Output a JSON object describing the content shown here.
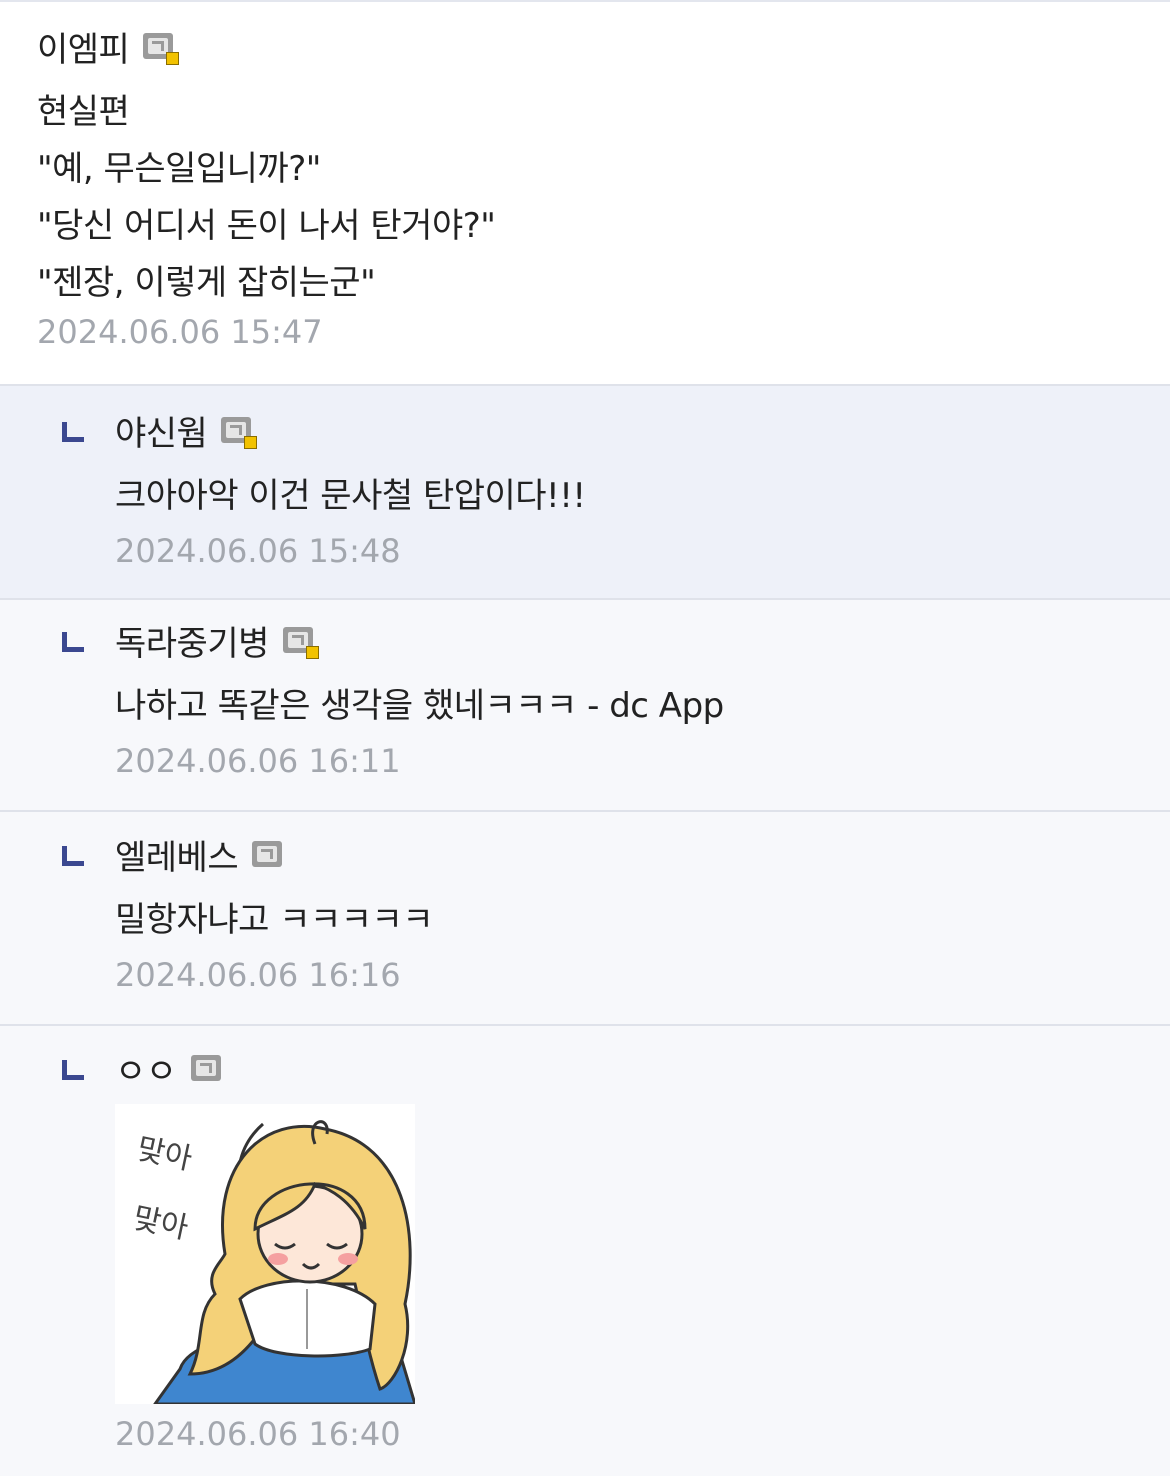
{
  "comments": [
    {
      "nick": "이엠피",
      "fixed": true,
      "lines": [
        "현실편",
        "\"예, 무슨일입니까?\"",
        "\"당신 어디서 돈이 나서 탄거야?\"",
        "\"젠장, 이렇게 잡히는군\""
      ],
      "date": "2024.06.06 15:47"
    },
    {
      "nick": "야신웜",
      "fixed": true,
      "lines": [
        "크아아악 이건 문사철 탄압이다!!!"
      ],
      "date": "2024.06.06 15:48"
    },
    {
      "nick": "독라중기병",
      "fixed": true,
      "lines": [
        "나하고 똑같은 생각을 했네ㅋㅋㅋ - dc App"
      ],
      "date": "2024.06.06 16:11"
    },
    {
      "nick": "엘레베스",
      "fixed": false,
      "lines": [
        "밀항자냐고 ㅋㅋㅋㅋㅋ"
      ],
      "date": "2024.06.06 16:16"
    },
    {
      "nick": "ㅇㅇ",
      "fixed": false,
      "sticker_text": [
        "맞아",
        "맞아"
      ],
      "date": "2024.06.06 16:40"
    }
  ],
  "colors": {
    "reply_mark": "#3b4890",
    "date": "#a3a7ae",
    "highlight_bg": "#eef1f9"
  }
}
